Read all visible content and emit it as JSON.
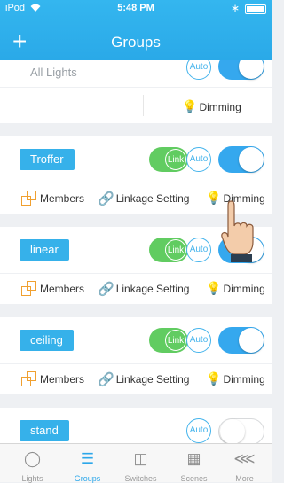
{
  "status_bar": {
    "carrier": "iPod",
    "time": "5:48 PM"
  },
  "header": {
    "add_label": "+",
    "title": "Groups"
  },
  "groups": [
    {
      "name": "All Lights",
      "auto_label": "Auto",
      "dimming_label": "Dimming"
    },
    {
      "name": "Troffer",
      "link_label": "Link",
      "auto_label": "Auto",
      "members_label": "Members",
      "linkage_label": "Linkage Setting",
      "dimming_label": "Dimming"
    },
    {
      "name": "linear",
      "link_label": "Link",
      "auto_label": "Auto",
      "members_label": "Members",
      "linkage_label": "Linkage Setting",
      "dimming_label": "Dimming"
    },
    {
      "name": "ceiling",
      "link_label": "Link",
      "auto_label": "Auto",
      "members_label": "Members",
      "linkage_label": "Linkage Setting",
      "dimming_label": "Dimming"
    },
    {
      "name": "stand",
      "auto_label": "Auto"
    }
  ],
  "tabs": [
    {
      "label": "Lights",
      "icon": "bulb-icon"
    },
    {
      "label": "Groups",
      "icon": "groups-icon"
    },
    {
      "label": "Switches",
      "icon": "switch-icon"
    },
    {
      "label": "Scenes",
      "icon": "scene-icon"
    },
    {
      "label": "More",
      "icon": "share-icon"
    }
  ],
  "colors": {
    "header": "#2aa9e8",
    "accent": "#35a8ee",
    "link_green": "#61cc61",
    "members_orange": "#f0a030"
  }
}
